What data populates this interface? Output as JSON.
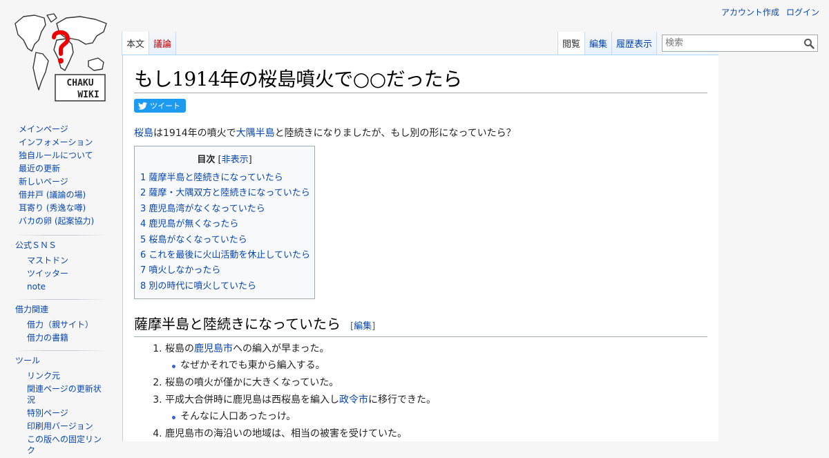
{
  "personal": {
    "create_account": "アカウント作成",
    "login": "ログイン"
  },
  "logo": {
    "text_line1": "CHAKU",
    "text_line2": "WIKI",
    "mark": "?"
  },
  "tabs_left": [
    {
      "label": "本文",
      "selected": true
    },
    {
      "label": "議論",
      "red": true
    }
  ],
  "tabs_right": [
    {
      "label": "閲覧",
      "selected": true
    },
    {
      "label": "編集"
    },
    {
      "label": "履歴表示"
    }
  ],
  "search": {
    "placeholder": "検索"
  },
  "page": {
    "title": "もし1914年の桜島噴火で○○だったら",
    "tweet_label": "ツイート",
    "intro": {
      "link1": "桜島",
      "text1": "は1914年の噴火で",
      "link2": "大隅半島",
      "text2": "と陸続きになりましたが、もし別の形になっていたら？"
    },
    "toc": {
      "title": "目次",
      "hide_open": "[",
      "hide_label": "非表示",
      "hide_close": "]",
      "items": [
        "1 薩摩半島と陸続きになっていたら",
        "2 薩摩・大隅双方と陸続きになっていたら",
        "3 鹿児島湾がなくなっていたら",
        "4 鹿児島が無くなったら",
        "5 桜島がなくなっていたら",
        "6 これを最後に火山活動を休止していたら",
        "7 噴火しなかったら",
        "8 別の時代に噴火していたら"
      ]
    },
    "section1": {
      "heading": "薩摩半島と陸続きになっていたら",
      "edit_open": "[",
      "edit_label": "編集",
      "edit_close": "]",
      "items": {
        "i1_a": "桜島の",
        "i1_link": "鹿児島市",
        "i1_b": "への編入が早まった。",
        "i1_sub": "なぜかそれでも東から編入する。",
        "i2": "桜島の噴火が僅かに大きくなっていた。",
        "i3_a": "平成大合併時に鹿児島は西桜島を編入し",
        "i3_link": "政令市",
        "i3_b": "に移行できた。",
        "i3_sub": "そんなに人口あったっけ。",
        "i4": "鹿児島市の海沿いの地域は、相当の被害を受けていた。"
      }
    }
  },
  "sidebar": {
    "main": [
      "メインページ",
      "インフォメーション",
      "独自ルールについて",
      "最近の更新",
      "新しいページ",
      "借井戸 (議論の場)",
      "耳寄り (秀逸な噂)",
      "バカの卵 (起案協力)"
    ],
    "sns": {
      "title": "公式ＳＮＳ",
      "items": [
        "マストドン",
        "ツイッター",
        "note"
      ]
    },
    "related": {
      "title": "借力関連",
      "items": [
        "借力（親サイト）",
        "借力の書籍"
      ]
    },
    "tools": {
      "title": "ツール",
      "items": [
        "リンク元",
        "関連ページの更新状況",
        "特別ページ",
        "印刷用バージョン",
        "この版への固定リンク"
      ]
    }
  },
  "colors": {
    "link": "#0645ad",
    "redlink": "#ba0000",
    "tweet": "#1d9bf0",
    "border": "#a7d7f9"
  }
}
